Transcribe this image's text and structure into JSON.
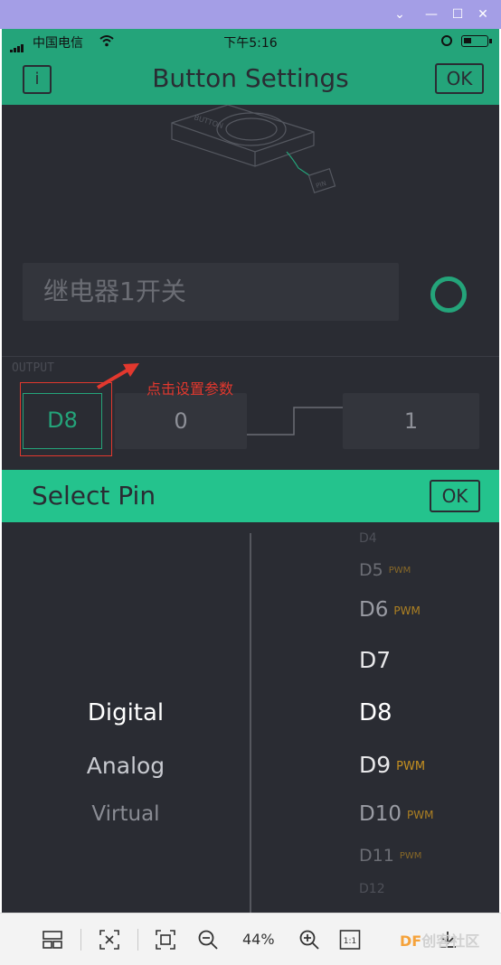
{
  "statusbar": {
    "carrier": "中国电信",
    "time": "下午5:16"
  },
  "header": {
    "info_label": "i",
    "title": "Button Settings",
    "ok_label": "OK"
  },
  "illustration": {
    "device_label": "BUTTON",
    "pin_label": "PIN"
  },
  "widget": {
    "name_placeholder": "继电器1开关"
  },
  "output": {
    "label": "OUTPUT",
    "pin": "D8",
    "low_value": "0",
    "high_value": "1"
  },
  "annotation": {
    "text": "点击设置参数",
    "color": "#e2382e"
  },
  "select_pin": {
    "title": "Select Pin",
    "ok_label": "OK"
  },
  "picker": {
    "categories": [
      "Digital",
      "Analog",
      "Virtual"
    ],
    "selected_category": "Digital",
    "pins": [
      {
        "name": "D4",
        "badge": ""
      },
      {
        "name": "D5",
        "badge": "PWM"
      },
      {
        "name": "D6",
        "badge": "PWM"
      },
      {
        "name": "D7",
        "badge": ""
      },
      {
        "name": "D8",
        "badge": ""
      },
      {
        "name": "D9",
        "badge": "PWM"
      },
      {
        "name": "D10",
        "badge": "PWM"
      },
      {
        "name": "D11",
        "badge": "PWM"
      },
      {
        "name": "D12",
        "badge": ""
      }
    ],
    "selected_pin": "D8"
  },
  "toolbar": {
    "zoom": "44%",
    "actual_size": "1:1",
    "watermark_brand": "DF",
    "watermark_text": "创客社区"
  },
  "colors": {
    "accent": "#24a47a",
    "select_bar": "#24c38d",
    "pwm": "#c69020",
    "background": "#2a2c33",
    "titlebar": "#a49ee6"
  }
}
